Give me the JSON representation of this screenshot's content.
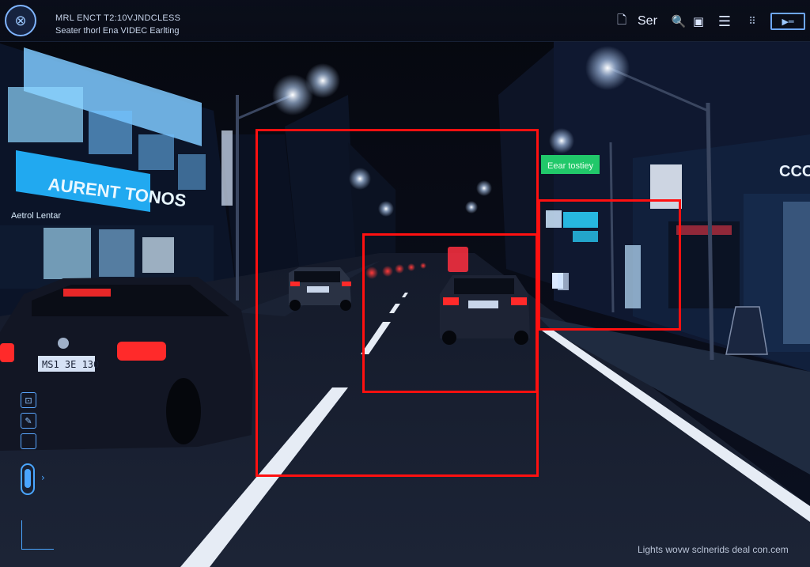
{
  "header": {
    "title_line1": "MRL ENCT T2:10VJNDCLESS",
    "title_line2": "Seater thorl Ena VIDEC Earlting",
    "label": "Ser"
  },
  "scene": {
    "store_sign_left": "AURENT TONOS",
    "store_sign_small": "Aetrol Lentar",
    "sign_green": "Eear tostiey",
    "sign_right": "CCC",
    "plate_left": "MS1 3E 130"
  },
  "toolbar": {
    "icons": [
      "file-icon",
      "search-icon",
      "window-icon",
      "menu-icon",
      "grid-icon",
      "video-icon"
    ]
  },
  "side_tools": [
    "crop-tool",
    "pen-tool",
    "square-tool",
    "slider-control"
  ],
  "detections_count_visible": 3,
  "colors": {
    "box_red": "#ff1010",
    "ui_accent": "#4aa6ff",
    "sign_cyan": "#2bd4ff",
    "sign_green": "#21c86a",
    "tail_light_red": "#ff2a2a"
  },
  "footer": {
    "watermark": "Lights wovw sclnerids deal con.cem"
  }
}
